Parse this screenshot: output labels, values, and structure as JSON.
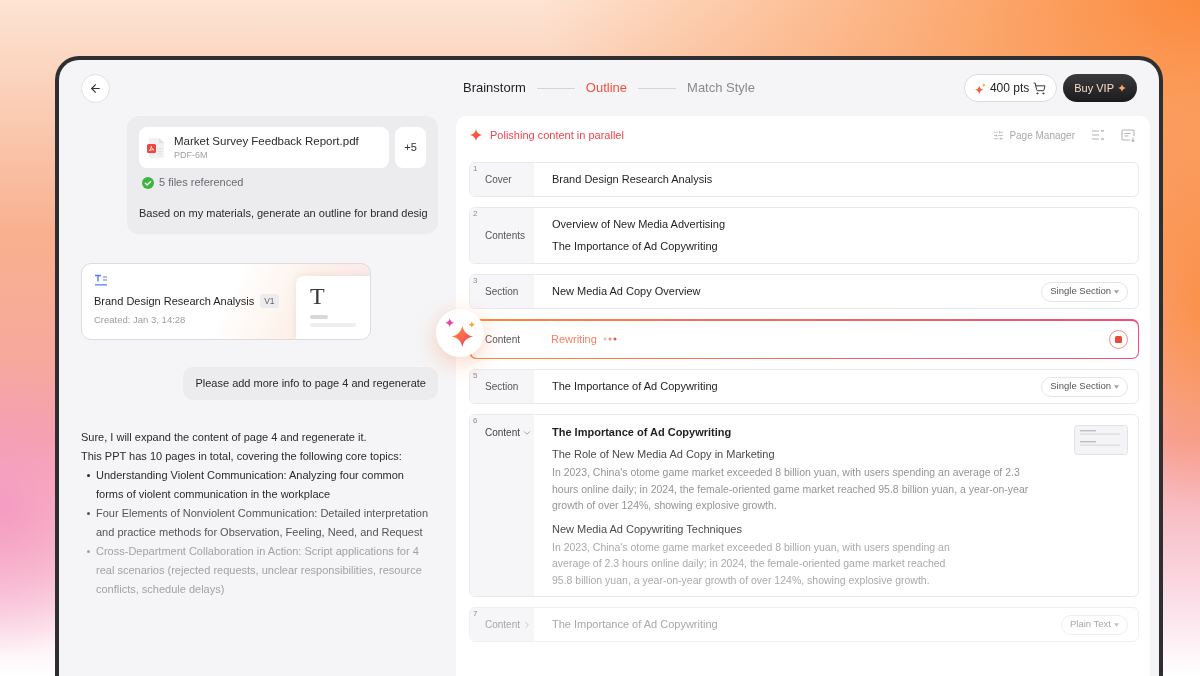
{
  "header": {
    "steps": [
      {
        "label": "Brainstorm",
        "selected": false
      },
      {
        "label": "Outline",
        "selected": true
      },
      {
        "label": "Match Style",
        "selected": false
      }
    ],
    "points_button": {
      "label": "400 pts"
    },
    "vip_button": {
      "label": "Buy VIP"
    }
  },
  "chat": {
    "file_message": {
      "file": {
        "name": "Market Survey Feedback Report.pdf",
        "meta": "PDF-6M"
      },
      "more_files": "+5",
      "referenced": "5 files referenced",
      "text": "Based on my materials, generate an outline for brand desig"
    },
    "document_card": {
      "title": "Brand Design Research Analysis",
      "version": "V1",
      "created": "Created: Jan 3, 14:28",
      "preview_letter": "T"
    },
    "user_message": "Please add more info to page 4 and regenerate",
    "reply": {
      "paragraphs": [
        "Sure, I will expand the content of page 4 and regenerate it.",
        "This PPT has 10 pages in total, covering the following core topics:"
      ],
      "bullets": [
        "Understanding Violent Communication: Analyzing four common forms of violent communication in the workplace",
        "Four Elements of Nonviolent Communication: Detailed interpretation and practice methods for Observation, Feeling, Need, and Request",
        "Cross-Department Collaboration in Action: Script applications for 4 real scenarios (rejected requests, unclear responsibilities, resource conflicts, schedule delays)"
      ]
    }
  },
  "outline": {
    "status": "Polishing content in parallel",
    "page_manager": "Page Manager",
    "rows": [
      {
        "kind": "simple",
        "number": "1",
        "label": "Cover",
        "lines": [
          "Brand Design Research Analysis"
        ]
      },
      {
        "kind": "simple",
        "number": "2",
        "label": "Contents",
        "lines": [
          "Overview of New Media Advertising",
          "The Importance of Ad Copywriting"
        ]
      },
      {
        "kind": "simple",
        "number": "3",
        "label": "Section",
        "lines": [
          "New Media Ad Copy Overview"
        ],
        "dropdown": "Single Section"
      },
      {
        "kind": "rewriting",
        "label": "Content",
        "status": "Rewriting"
      },
      {
        "kind": "simple",
        "number": "5",
        "label": "Section",
        "lines": [
          "The Importance of Ad Copywriting"
        ],
        "dropdown": "Single Section"
      },
      {
        "kind": "detail",
        "number": "6",
        "label": "Content",
        "expanded": true,
        "title": "The Importance of Ad Copywriting",
        "blocks": [
          {
            "heading": "The Role of New Media Ad Copy in Marketing",
            "body": "In 2023, China's otome game market exceeded 8 billion yuan, with users spending an average of 2.3 hours online daily; in 2024, the female-oriented game market reached 95.8 billion yuan, a year-on-year growth of over 124%, showing explosive growth."
          },
          {
            "heading": "New Media Ad Copywriting Techniques",
            "body": "In 2023, China's otome game market exceeded 8 billion yuan, with users spending an average of 2.3 hours online daily; in 2024, the female-oriented game market reached 95.8 billion yuan, a year-on-year growth of over 124%, showing explosive growth."
          }
        ]
      },
      {
        "kind": "simple",
        "number": "7",
        "label": "Content",
        "expanded": false,
        "lines": [
          "The Importance of Ad Copywriting"
        ],
        "dropdown": "Plain Text"
      }
    ]
  }
}
